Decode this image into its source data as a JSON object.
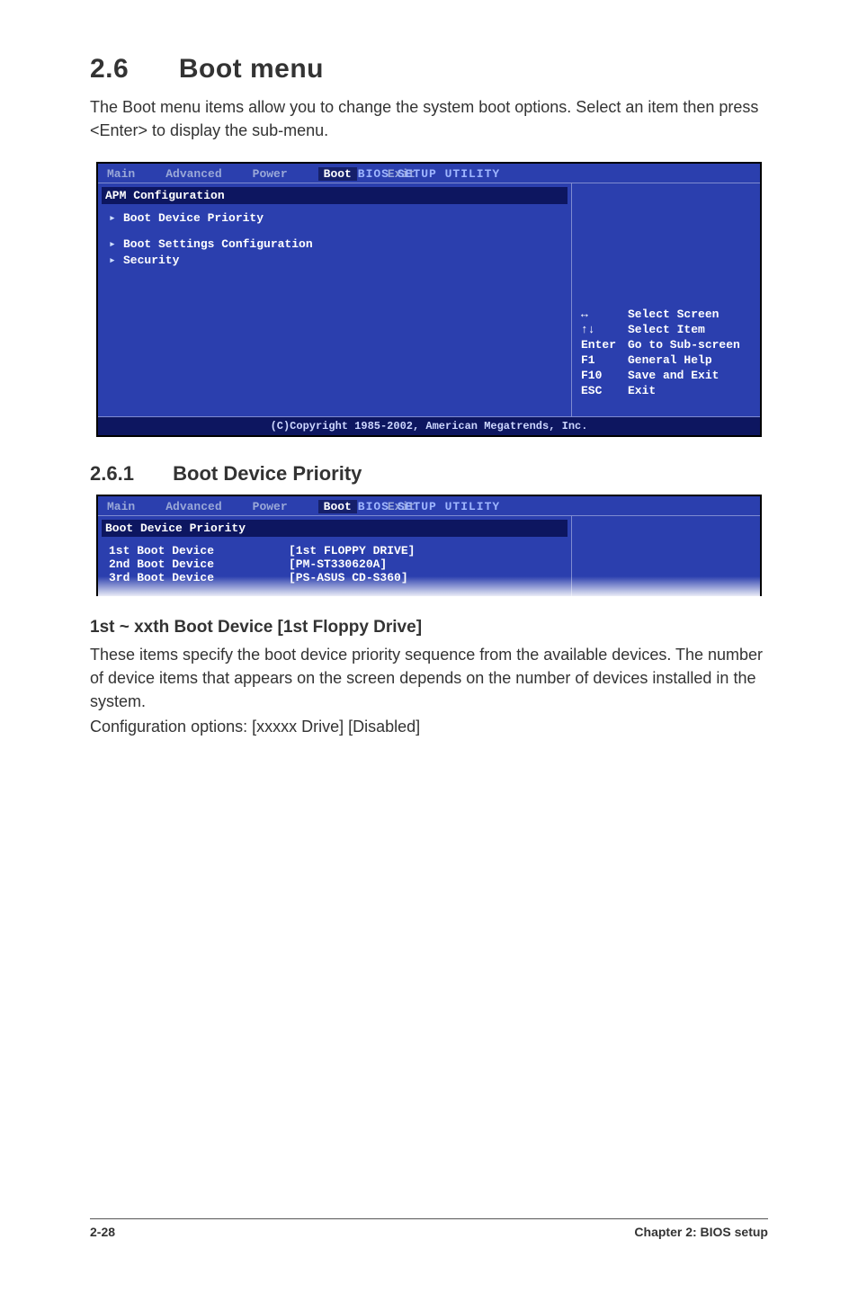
{
  "section": {
    "number": "2.6",
    "title": "Boot menu",
    "intro": "The Boot menu items allow you to change the system boot options. Select an item then press <Enter> to display the sub-menu."
  },
  "bios1": {
    "util_title": "BIOS SETUP UTILITY",
    "tabs": {
      "main": "Main",
      "advanced": "Advanced",
      "power": "Power",
      "boot": "Boot",
      "exit": "Exit"
    },
    "panel_header": "APM Configuration",
    "items": {
      "boot_priority": "Boot Device Priority",
      "boot_settings": "Boot Settings Configuration",
      "security": "Security"
    },
    "help": {
      "select_screen": "Select Screen",
      "select_item": "Select Item",
      "enter_key": "Enter",
      "enter_txt": "Go to Sub-screen",
      "f1_key": "F1",
      "f1_txt": "General Help",
      "f10_key": "F10",
      "f10_txt": "Save and Exit",
      "esc_key": "ESC",
      "esc_txt": "Exit"
    },
    "copyright": "(C)Copyright 1985-2002, American Megatrends, Inc."
  },
  "subsection": {
    "number": "2.6.1",
    "title": "Boot Device Priority"
  },
  "bios2": {
    "util_title": "BIOS SETUP UTILITY",
    "tabs": {
      "main": "Main",
      "advanced": "Advanced",
      "power": "Power",
      "boot": "Boot",
      "exit": "Exit"
    },
    "panel_header": "Boot Device Priority",
    "rows": {
      "r1k": "1st Boot Device",
      "r1v": "[1st FLOPPY DRIVE]",
      "r2k": "2nd Boot Device",
      "r2v": "[PM-ST330620A]",
      "r3k": "3rd Boot Device",
      "r3v": "[PS-ASUS CD-S360]"
    }
  },
  "option_block": {
    "heading": "1st ~ xxth Boot Device [1st Floppy Drive]",
    "p1": "These items specify the boot device priority sequence from the available devices. The number of device items that appears on the screen depends on the number of devices installed in the system.",
    "p2": "Configuration options: [xxxxx Drive] [Disabled]"
  },
  "footer": {
    "page": "2-28",
    "chapter": "Chapter 2: BIOS setup"
  }
}
